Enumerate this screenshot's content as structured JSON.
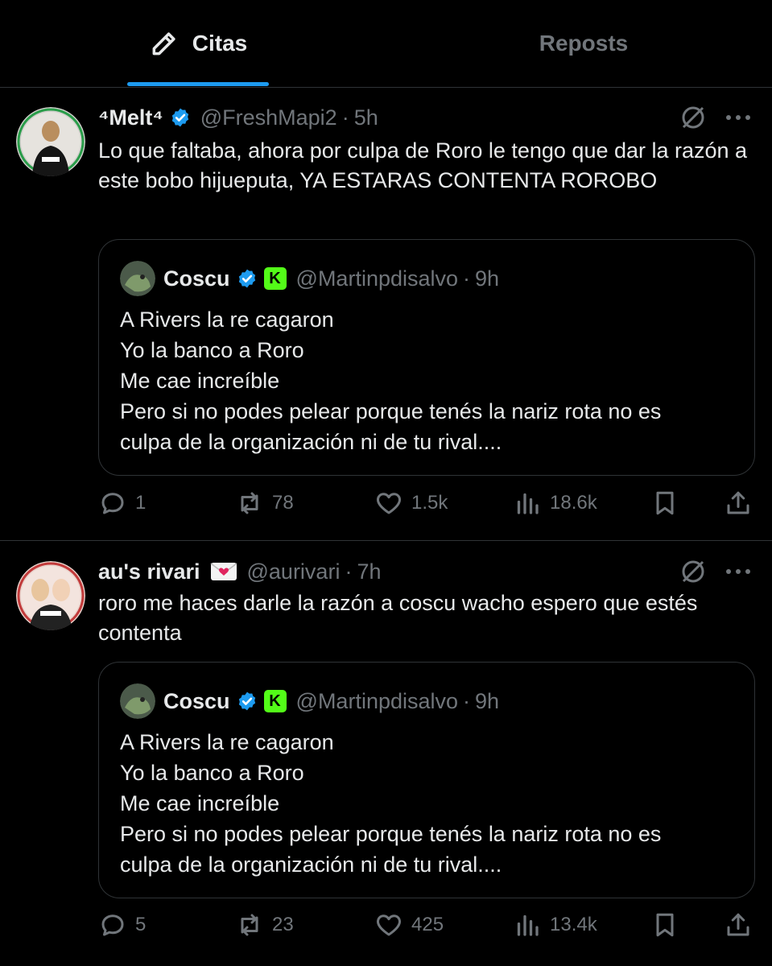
{
  "tabs": [
    {
      "label": "Citas",
      "icon": "pencil-icon",
      "active": true
    },
    {
      "label": "Reposts",
      "active": false
    }
  ],
  "colors": {
    "accent": "#1d9bf0",
    "muted": "#71767b",
    "text": "#e7e9ea",
    "kick": "#53fc18"
  },
  "posts": [
    {
      "name": "⁴Melt⁴",
      "handle": "@FreshMapi2",
      "sep": "·",
      "time": "5h",
      "text": "Lo que faltaba, ahora por culpa de Roro le tengo que dar la razón a este bobo hijueputa, YA ESTARAS CONTENTA ROROBO",
      "quote": {
        "name": "Coscu",
        "badge": "K",
        "handle": "@Martinpdisalvo",
        "sep": "·",
        "time": "9h",
        "lines": [
          "A Rivers la re cagaron",
          "Yo la banco a Roro",
          "Me cae increíble",
          "Pero si no podes pelear porque tenés la nariz rota no es",
          "culpa de la organización ni de tu rival...."
        ]
      },
      "stats": {
        "replies": "1",
        "reposts": "78",
        "likes": "1.5k",
        "views": "18.6k"
      }
    },
    {
      "name": "au's rivari",
      "handle": "@aurivari",
      "sep": "·",
      "time": "7h",
      "text": "roro me haces darle la razón a coscu wacho espero que estés contenta",
      "quote": {
        "name": "Coscu",
        "badge": "K",
        "handle": "@Martinpdisalvo",
        "sep": "·",
        "time": "9h",
        "lines": [
          "A Rivers la re cagaron",
          "Yo la banco a Roro",
          "Me cae increíble",
          "Pero si no podes pelear porque tenés la nariz rota no es",
          "culpa de la organización ni de tu rival...."
        ]
      },
      "stats": {
        "replies": "5",
        "reposts": "23",
        "likes": "425",
        "views": "13.4k"
      }
    }
  ]
}
